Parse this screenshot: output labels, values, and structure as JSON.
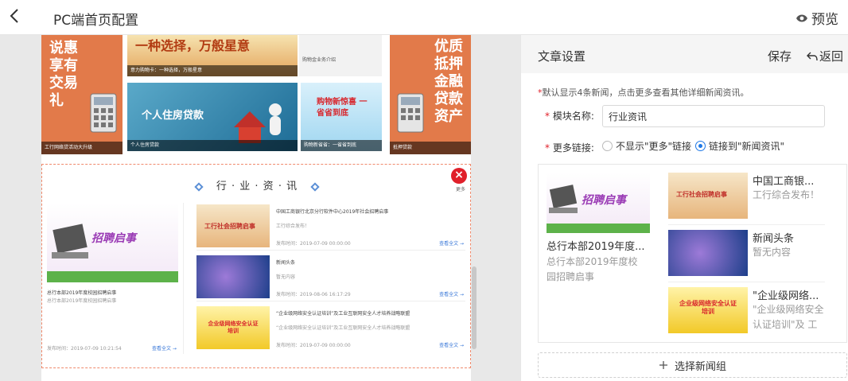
{
  "header": {
    "title": "PC端首页配置",
    "preview_label": "预览"
  },
  "canvas": {
    "banners": {
      "left_text": "说惠享有交易礼",
      "left_caption": "工行网络贷活动大升级",
      "right_text": "优质抵押金融贷款资产",
      "right_caption": "抵押贷款",
      "tile1_caption": "意力购物卡：一种选择，万般星意",
      "tile1_banner": "一种选择，万般星意",
      "tile2_caption": "个人住房贷款",
      "tile2_banner": "个人住房贷款",
      "tile3_text": "购物新惊喜 一省省到底",
      "tile3_caption": "购物新省省：一省省到底",
      "tile4_caption": "购物金业务介绍"
    },
    "module": {
      "title": "行 · 业 · 资 · 讯",
      "close": "×",
      "more": "更多",
      "featured": {
        "banner_text": "招聘启事",
        "title": "总行本部2019年度校园招聘启事",
        "summary": "总行本部2019年度校园招聘启事",
        "date": "发布时间：2019-07-09 10:21:54",
        "more": "查看全文 →"
      },
      "list": [
        {
          "banner_text": "工行社会招聘启事",
          "title": "中国工商银行北京分行软件中心2019年社会招聘启事",
          "summary": "工行综合发布！",
          "date": "发布时间：2019-07-09 00:00:00",
          "more": "查看全文 →"
        },
        {
          "banner_text": "",
          "title": "新闻头条",
          "summary": "暂无内容",
          "date": "发布时间：2019-08-06 16:17:29",
          "more": "查看全文 →"
        },
        {
          "banner_text": "企业级网络安全认证培训",
          "title": "“企业级网络安全认证培训”及工业互联网安全人才培养战略联盟",
          "summary": "“企业级网络安全认证培训”及工业互联网安全人才培养战略联盟",
          "date": "发布时间：2019-07-09 00:00:00",
          "more": "查看全文 →"
        }
      ]
    }
  },
  "panel": {
    "title": "文章设置",
    "save": "保存",
    "back": "返回",
    "hint_star": "*",
    "hint": "默认显示4条新闻，点击更多查看其他详细新闻资讯。",
    "name_label": "模块名称:",
    "name_value": "行业资讯",
    "more_label": "更多链接:",
    "radio_hide": "不显示\"更多\"链接",
    "radio_link": "链接到\"新闻资讯\"",
    "preview": {
      "featured_banner": "招聘启事",
      "featured_title": "总行本部2019年度...",
      "featured_summary": "总行本部2019年度校园招聘启事",
      "items": [
        {
          "banner_text": "工行社会招聘启事",
          "title": "中国工商银...",
          "summary": "工行综合发布！"
        },
        {
          "banner_text": "",
          "title": "新闻头条",
          "summary": "暂无内容"
        },
        {
          "banner_text": "企业级网络安全认证培训",
          "title": "\"企业级网络...",
          "summary": "\"企业级网络安全认证培训\"及 工"
        }
      ]
    },
    "select_group": "选择新闻组"
  },
  "colors": {
    "accent": "#1e78e6",
    "danger": "#e0202a",
    "banner_orange": "#e27a4a"
  }
}
